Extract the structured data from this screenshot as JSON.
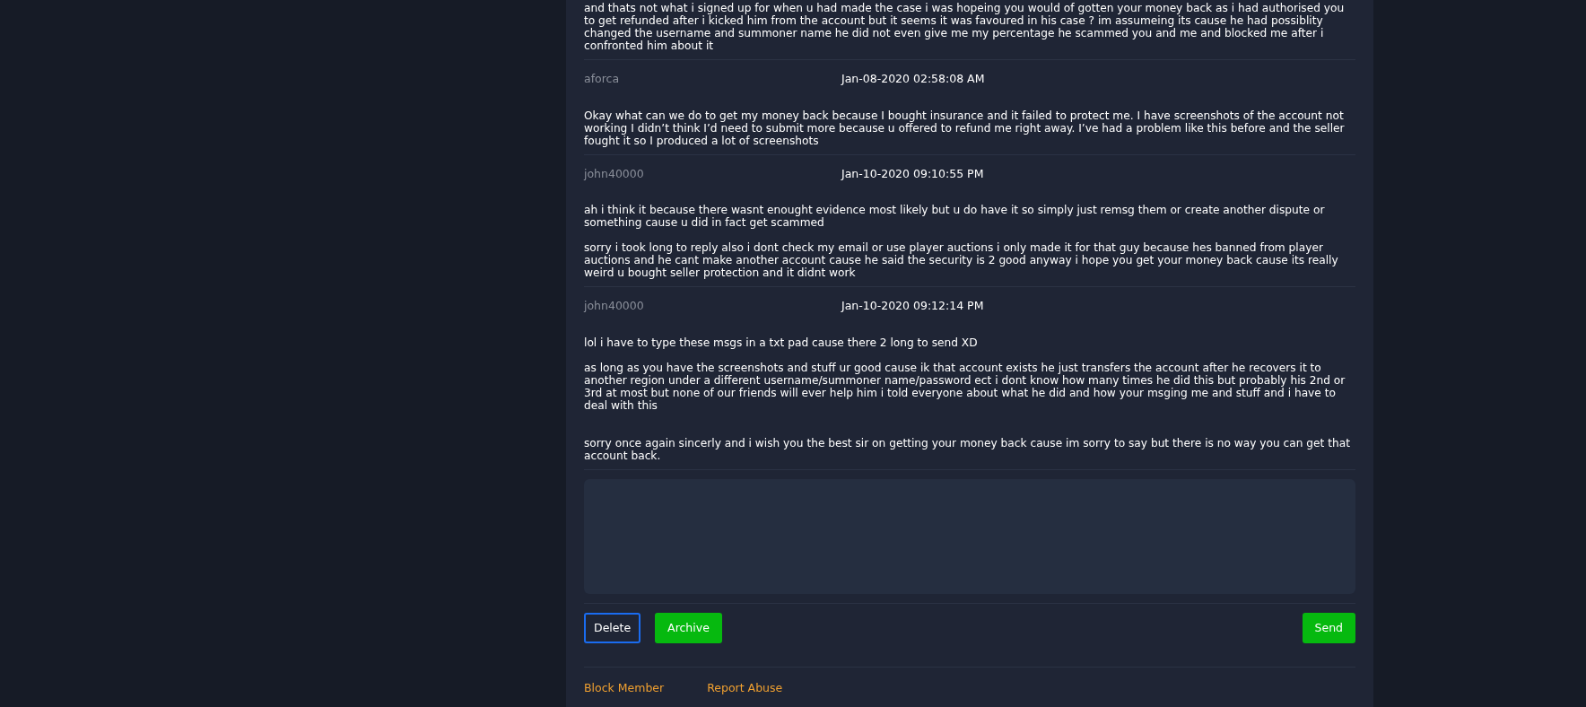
{
  "messages": [
    {
      "paragraphs": [
        "and thats not what i signed up for when u had made the case i was hopeing you would of gotten your money back as i had authorised you to get refunded after i kicked him from the account but it seems it was favoured in his case ? im assumeing its cause he had possiblity changed the username and summoner name he did not even give me my percentage he scammed you and me and blocked me after i confronted him about it"
      ]
    },
    {
      "author": "aforca",
      "date": "Jan-08-2020 02:58:08 AM",
      "paragraphs": [
        "Okay what can we do to get my money back because I bought insurance and it failed to protect me. I have screenshots of the account not working I didn’t think I’d need to submit more because u offered to refund me right away. I’ve had a problem like this before and the seller fought it so I produced a lot of screenshots"
      ]
    },
    {
      "author": "john40000",
      "date": "Jan-10-2020 09:10:55 PM",
      "paragraphs": [
        "ah i think it because there wasnt enought evidence most likely but u do have it so simply just remsg them or create another dispute or something cause u did in fact get scammed",
        "sorry i took long to reply also i dont check my email or use player auctions i only made it for that guy because hes banned from player auctions and he cant make another account cause he said the security is 2 good anyway i hope you get your money back cause its really weird u bought seller protection and it didnt work"
      ]
    },
    {
      "author": "john40000",
      "date": "Jan-10-2020 09:12:14 PM",
      "paragraphs": [
        "lol i have to type these msgs in a txt pad cause there 2 long to send XD",
        "as long as you have the screenshots and stuff ur good cause ik that account exists he just transfers the account after he recovers it to another region under a different username/summoner name/password ect i dont know how many times he did this but probably his 2nd or 3rd at most but none of our friends will ever help him i told everyone about what he did and how your msging me and stuff and i have to deal with this",
        "sorry once again sincerly and i wish you the best sir on getting your money back cause im sorry to say but there is no way you can get that account back."
      ]
    }
  ],
  "left_buttons": [
    {
      "label": "Delete",
      "kind": "outline"
    },
    {
      "label": "Archive",
      "kind": "success"
    }
  ],
  "right_buttons": [
    {
      "label": "Send",
      "kind": "success"
    }
  ],
  "links": [
    "Block Member",
    "Report Abuse"
  ]
}
